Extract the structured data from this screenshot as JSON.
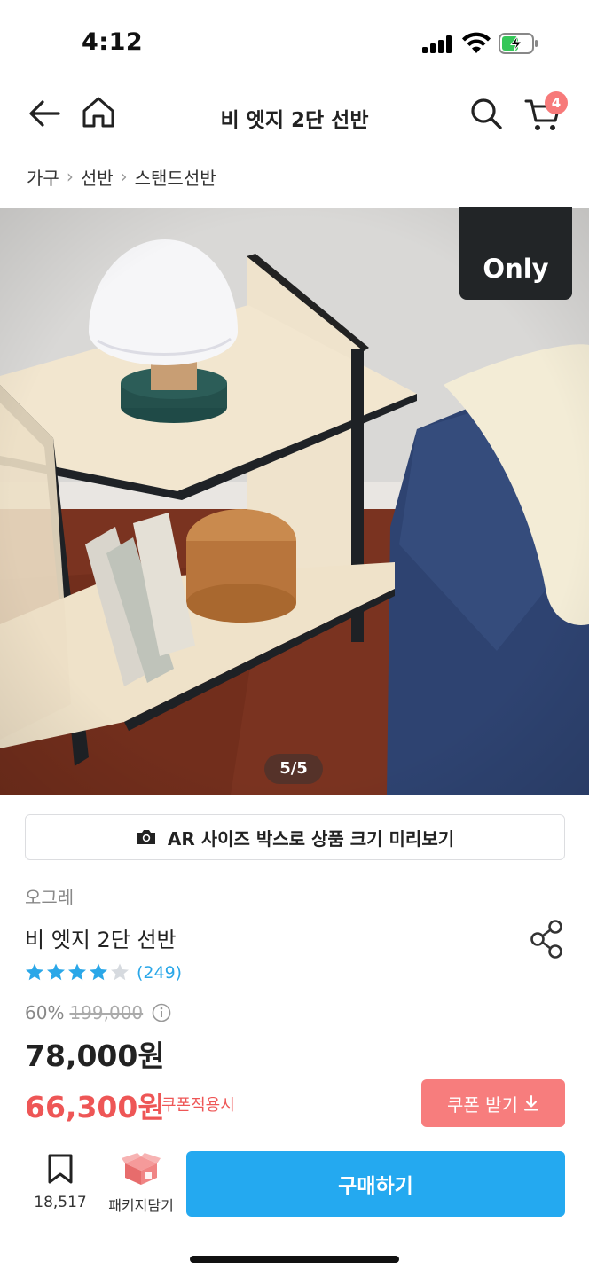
{
  "status_bar": {
    "time": "4:12"
  },
  "nav": {
    "title": "비 엣지 2단 선반",
    "cart_count": "4"
  },
  "breadcrumb": [
    "가구",
    "선반",
    "스탠드선반"
  ],
  "product_image": {
    "badge": "Only",
    "counter": "5/5"
  },
  "ar_button": {
    "label": "AR 사이즈 박스로 상품 크기 미리보기"
  },
  "product": {
    "brand": "오그레",
    "name": "비 엣지 2단 선반",
    "rating": 4.5,
    "review_count": "(249)",
    "discount_pct": "60%",
    "original_price": "199,000",
    "sale_price": "78,000원",
    "coupon_price": "66,300원",
    "coupon_label": "쿠폰적용시"
  },
  "coupon_button": {
    "label": "쿠폰 받기"
  },
  "bottom_bar": {
    "bookmark_count": "18,517",
    "package_label": "패키지담기",
    "buy_label": "구매하기"
  },
  "colors": {
    "accent_blue": "#24a9f0",
    "coupon_red": "#ee5656",
    "coupon_button": "#f77d7d",
    "star_blue": "#2aa7e8",
    "badge": "#f77a7a"
  }
}
